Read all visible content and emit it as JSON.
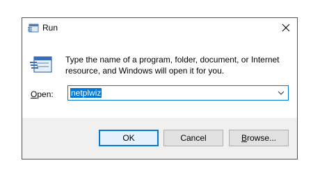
{
  "window": {
    "title": "Run",
    "title_icon": "run-icon",
    "close_icon": "close-icon"
  },
  "description": "Type the name of a program, folder, document, or Internet resource, and Windows will open it for you.",
  "open": {
    "label_accel": "O",
    "label_rest": "pen:",
    "value": "netplwiz"
  },
  "buttons": {
    "ok": "OK",
    "cancel": "Cancel",
    "browse_accel": "B",
    "browse_rest": "rowse..."
  },
  "colors": {
    "accent": "#0078d7",
    "footer_bg": "#f0f0f0",
    "border": "#2b5797"
  }
}
